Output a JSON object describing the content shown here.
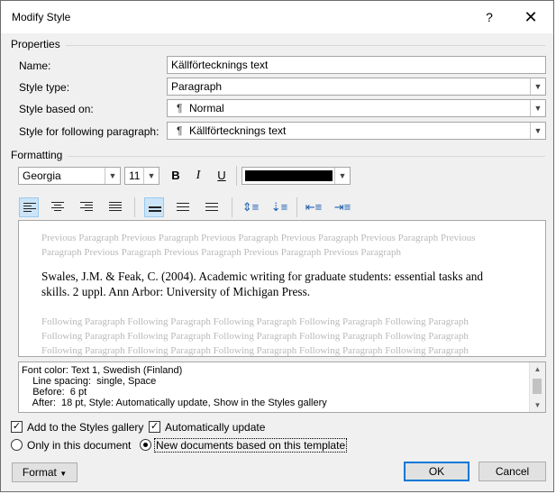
{
  "dialog": {
    "title": "Modify Style",
    "help_icon": "question-mark-icon",
    "close_icon": "close-icon"
  },
  "properties": {
    "section_label": "Properties",
    "name_label": "Name:",
    "name_value": "Källförtecknings text",
    "style_type_label": "Style type:",
    "style_type_value": "Paragraph",
    "based_on_label": "Style based on:",
    "based_on_value": "Normal",
    "following_label": "Style for following paragraph:",
    "following_value": "Källförtecknings text"
  },
  "formatting": {
    "section_label": "Formatting",
    "font": "Georgia",
    "size": "11",
    "bold": "B",
    "italic": "I",
    "underline": "U",
    "font_color": "#000000"
  },
  "preview": {
    "previous_text": "Previous Paragraph Previous Paragraph Previous Paragraph Previous Paragraph Previous Paragraph Previous Paragraph Previous Paragraph Previous Paragraph Previous Paragraph Previous Paragraph",
    "sample_text": "Swales, J.M. & Feak, C. (2004). Academic writing for graduate students: essential tasks and skills. 2 uppl. Ann Arbor: University of Michigan Press.",
    "following_lines": [
      "Following Paragraph Following Paragraph Following Paragraph Following Paragraph Following Paragraph",
      "Following Paragraph Following Paragraph Following Paragraph Following Paragraph Following Paragraph",
      "Following Paragraph Following Paragraph Following Paragraph Following Paragraph Following Paragraph"
    ]
  },
  "description": {
    "lines": [
      "Font color: Text 1, Swedish (Finland)",
      "    Line spacing:  single, Space",
      "    Before:  6 pt",
      "    After:  18 pt, Style: Automatically update, Show in the Styles gallery"
    ]
  },
  "options": {
    "add_to_gallery": "Add to the Styles gallery",
    "add_to_gallery_checked": true,
    "auto_update": "Automatically update",
    "auto_update_checked": true,
    "only_this_doc": "Only in this document",
    "new_docs": "New documents based on this template",
    "selected_scope": "new_docs"
  },
  "buttons": {
    "format": "Format",
    "ok": "OK",
    "cancel": "Cancel"
  }
}
